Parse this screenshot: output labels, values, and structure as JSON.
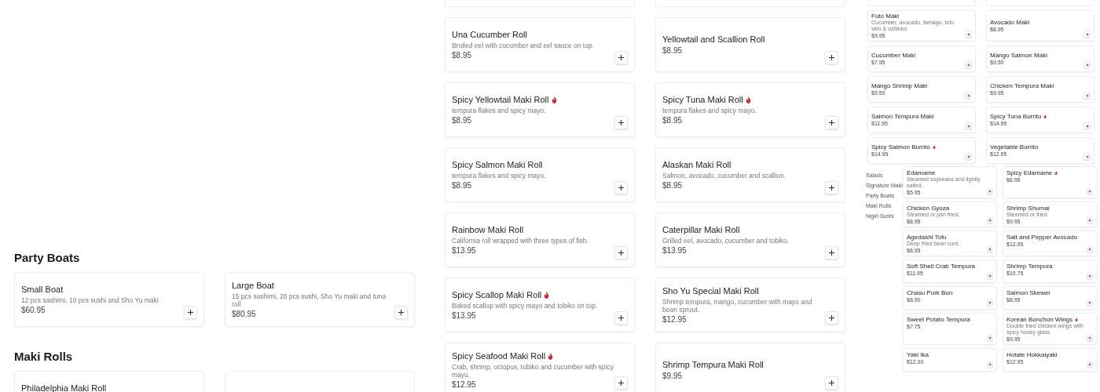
{
  "left": {
    "sections": [
      {
        "title": "Party Boats",
        "items": [
          {
            "name": "Small Boat",
            "spicy": false,
            "description": "12 pcs sashimi, 10 pcs sushi and Sho Yu maki",
            "price": "$60.95"
          },
          {
            "name": "Large Boat",
            "spicy": false,
            "description": "15 pcs sashimi, 20 pcs sushi, Sho Yu maki and tuna roll",
            "price": "$80.95"
          }
        ]
      },
      {
        "title": "Maki Rolls",
        "items": [
          {
            "name": "Philadelphia Maki Roll",
            "spicy": false
          }
        ]
      }
    ]
  },
  "middle": {
    "items": [
      {
        "name": "Una Cucumber Roll",
        "spicy": false,
        "description": "Broiled eel with cucumber and eel sauce on top.",
        "price": "$8.95"
      },
      {
        "name": "Yellowtail and Scallion Roll",
        "spicy": false,
        "price": "$8.95"
      },
      {
        "name": "Spicy Yellowtail Maki Roll",
        "spicy": true,
        "description": "tempura flakes and spicy mayo.",
        "price": "$8.95"
      },
      {
        "name": "Spicy Tuna Maki Roll",
        "spicy": true,
        "description": "tempura flakes and spicy mayo.",
        "price": "$8.95"
      },
      {
        "name": "Spicy Salmon Maki Roll",
        "spicy": false,
        "description": "tempura flakes and spicy mayo.",
        "price": "$8.95"
      },
      {
        "name": "Alaskan Maki Roll",
        "spicy": false,
        "description": "Salmon, avocado, cucumber and scallion.",
        "price": "$8.95"
      },
      {
        "name": "Rainbow Maki Roll",
        "spicy": false,
        "description": "California roll wrapped with three types of fish.",
        "price": "$13.95"
      },
      {
        "name": "Caterpillar Maki Roll",
        "spicy": false,
        "description": "Grilled eel, avocado, cucumber and tobiko.",
        "price": "$13.95"
      },
      {
        "name": "Spicy Scallop Maki Roll",
        "spicy": true,
        "description": "Baked scallop with spicy mayo and tobiko on top.",
        "price": "$13.95"
      },
      {
        "name": "Sho Yu Special Maki Roll",
        "spicy": false,
        "description": "Shrimp tempura, mango, cucumber with mayo and bean sprout.",
        "price": "$12.95"
      },
      {
        "name": "Spicy Seafood Maki Roll",
        "spicy": true,
        "description": "Crab, shrimp, octopus, tobiko and cucumber with spicy mayo.",
        "price": "$12.95"
      },
      {
        "name": "Shrimp Tempura Maki Roll",
        "spicy": false,
        "price": "$9.95"
      }
    ]
  },
  "right": {
    "items": [
      {
        "name": "Futo Maki",
        "spicy": false,
        "description": "Cucumber, avocado, tamago, tofu skin & oshinko",
        "price": "$9.95"
      },
      {
        "name": "Avocado Maki",
        "spicy": false,
        "price": "$8.95"
      },
      {
        "name": "Cucumber Maki",
        "spicy": false,
        "price": "$7.95"
      },
      {
        "name": "Mango Salmon Maki",
        "spicy": false,
        "price": "$9.50"
      },
      {
        "name": "Mango Shrimp Maki",
        "spicy": false,
        "price": "$9.50"
      },
      {
        "name": "Chicken Tempura Maki",
        "spicy": false,
        "price": "$9.95"
      },
      {
        "name": "Salmon Tempura Maki",
        "spicy": false,
        "price": "$11.95"
      },
      {
        "name": "Spicy Tuna Burrito",
        "spicy": true,
        "price": "$14.95"
      },
      {
        "name": "Spicy Salmon Burrito",
        "spicy": true,
        "price": "$14.95"
      },
      {
        "name": "Vegetable Burrito",
        "spicy": false,
        "price": "$12.95"
      }
    ],
    "sidebar": {
      "items": [
        {
          "label": "Salads"
        },
        {
          "label": "Signature Maki"
        },
        {
          "label": "Party Boats"
        },
        {
          "label": "Maki Rolls"
        },
        {
          "label": "Nigiri Sushi"
        }
      ]
    },
    "appetizers": [
      {
        "name": "Edamame",
        "spicy": false,
        "description": "Steamed soybeans and lightly salted.",
        "price": "$5.95"
      },
      {
        "name": "Spicy Edamame",
        "spicy": true,
        "price": "$6.95"
      },
      {
        "name": "Chicken Gyoza",
        "spicy": false,
        "description": "Steamed or pan fried.",
        "price": "$8.95"
      },
      {
        "name": "Shrimp Shumai",
        "spicy": false,
        "description": "Steamed or fried.",
        "price": "$9.95"
      },
      {
        "name": "Agedashi Tofu",
        "spicy": false,
        "description": "Deep fried bean curd.",
        "price": "$8.95"
      },
      {
        "name": "Salt and Pepper Avocado",
        "spicy": false,
        "price": "$12.95"
      },
      {
        "name": "Soft Shell Crab Tempura",
        "spicy": false,
        "price": "$11.95"
      },
      {
        "name": "Shrimp Tempura",
        "spicy": false,
        "price": "$10.75"
      },
      {
        "name": "Chasu Pork Bun",
        "spicy": false,
        "price": "$8.00"
      },
      {
        "name": "Salmon Skewer",
        "spicy": false,
        "price": "$8.95"
      },
      {
        "name": "Sweet Potato Tempura",
        "spicy": false,
        "price": "$7.75"
      },
      {
        "name": "Korean Bonchon Wings",
        "spicy": true,
        "description": "Double fried chicken wings with spicy honey glaze.",
        "price": "$9.95"
      },
      {
        "name": "Yaki Ika",
        "spicy": false,
        "price": "$12.00"
      },
      {
        "name": "Hotate Hokkaiyaki",
        "spicy": false,
        "price": "$12.95"
      }
    ]
  }
}
